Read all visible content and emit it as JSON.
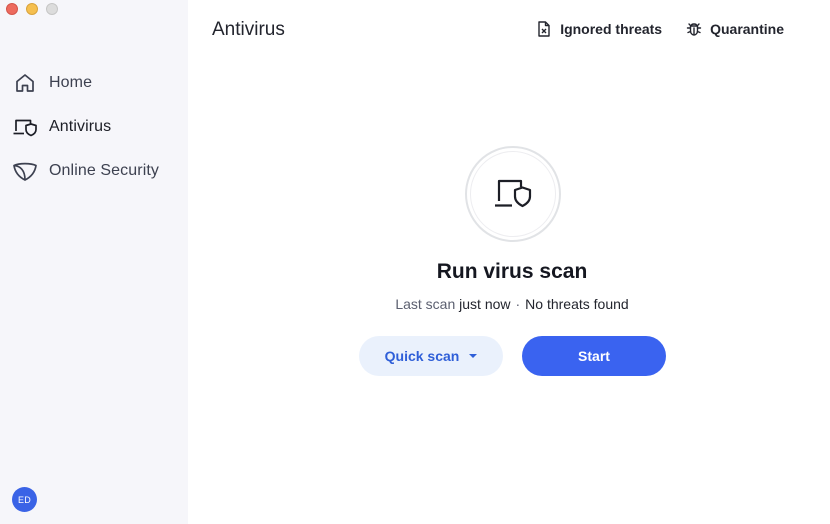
{
  "window": {
    "controls": [
      "close",
      "minimize",
      "maximize"
    ]
  },
  "sidebar": {
    "items": [
      {
        "label": "Home",
        "icon": "home-icon",
        "active": false
      },
      {
        "label": "Antivirus",
        "icon": "antivirus-icon",
        "active": true
      },
      {
        "label": "Online Security",
        "icon": "shield-icon",
        "active": false
      }
    ],
    "avatar_initials": "ED"
  },
  "header": {
    "title": "Antivirus",
    "ignored_threats_label": "Ignored threats",
    "ignored_threats_icon": "document-x-icon",
    "quarantine_label": "Quarantine",
    "quarantine_icon": "bug-icon"
  },
  "scan": {
    "hero_icon": "laptop-shield-icon",
    "title": "Run virus scan",
    "last_scan_label": "Last scan",
    "last_scan_value": "just now",
    "separator": "·",
    "status": "No threats found",
    "scan_type": "Quick scan",
    "start_label": "Start"
  },
  "colors": {
    "sidebar_bg": "#f6f6fa",
    "accent": "#3a63f0",
    "secondary_button_bg": "#eaf1fc",
    "avatar_bg": "#3a63e6"
  }
}
